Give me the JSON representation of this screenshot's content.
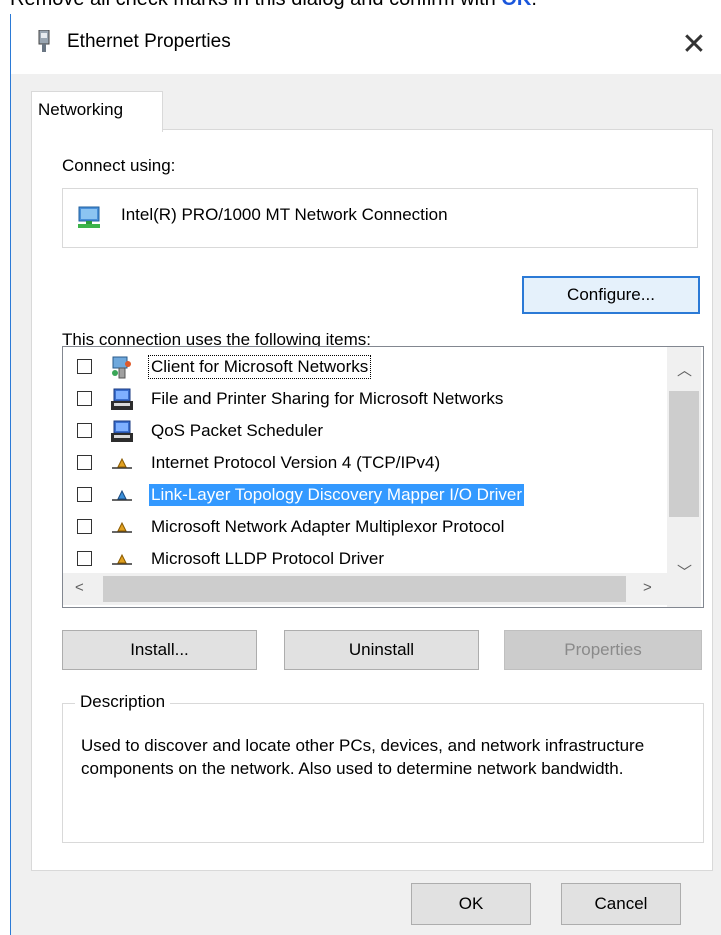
{
  "instruction": {
    "text_before": "Remove all check marks in this dialog and confirm with ",
    "ok_word": "OK",
    "text_after": "."
  },
  "dialog": {
    "title": "Ethernet Properties",
    "close_glyph": "✕",
    "tab_label": "Networking",
    "connect_using_label": "Connect using:",
    "adapter_name": "Intel(R) PRO/1000 MT Network Connection",
    "configure_button": "Configure...",
    "items_label": "This connection uses the following items:",
    "items": [
      {
        "label": "Client for Microsoft Networks",
        "checked": false,
        "icon": "network-client-icon"
      },
      {
        "label": "File and Printer Sharing for Microsoft Networks",
        "checked": false,
        "icon": "printer-sharing-icon"
      },
      {
        "label": "QoS Packet Scheduler",
        "checked": false,
        "icon": "printer-sharing-icon"
      },
      {
        "label": "Internet Protocol Version 4 (TCP/IPv4)",
        "checked": false,
        "icon": "protocol-icon"
      },
      {
        "label": "Link-Layer Topology Discovery Mapper I/O Driver",
        "checked": false,
        "icon": "protocol-icon",
        "selected": true
      },
      {
        "label": "Microsoft Network Adapter Multiplexor Protocol",
        "checked": false,
        "icon": "protocol-icon"
      },
      {
        "label": "Microsoft LLDP Protocol Driver",
        "checked": false,
        "icon": "protocol-icon"
      }
    ],
    "install_button": "Install...",
    "uninstall_button": "Uninstall",
    "properties_button": "Properties",
    "description_title": "Description",
    "description_text": "Used to discover and locate other PCs, devices, and network infrastructure components on the network.  Also used to determine network bandwidth.",
    "ok_button": "OK",
    "cancel_button": "Cancel"
  },
  "colors": {
    "selection": "#3399ff",
    "accent_border": "#2b7ad6",
    "link": "#1a56db"
  }
}
